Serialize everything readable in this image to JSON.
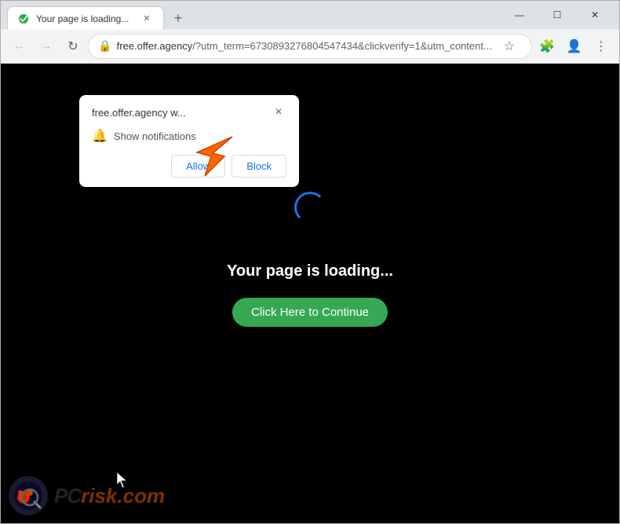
{
  "window": {
    "title": "Your page is loading...",
    "favicon": "✓",
    "new_tab_label": "+",
    "controls": {
      "minimize": "—",
      "maximize": "☐",
      "close": "✕"
    }
  },
  "toolbar": {
    "back": "←",
    "forward": "→",
    "reload": "↻",
    "address": "free.offer.agency/?utm_term=6730893276804547434&clickverify=1&utm_content...",
    "address_highlight": "free.offer.agency",
    "address_rest": "/?utm_term=6730893276804547434&clickverify=1&utm_content...",
    "star": "☆",
    "extensions": "🧩",
    "profile": "👤",
    "menu": "⋮"
  },
  "popup": {
    "site": "free.offer.agency w...",
    "notification_text": "Show notifications",
    "allow_label": "Allow",
    "block_label": "Block",
    "close": "×"
  },
  "page": {
    "loading_text": "Your page is loading...",
    "continue_label": "Click Here to Continue"
  },
  "watermark": {
    "brand": "risk.com",
    "prefix": "PC"
  }
}
